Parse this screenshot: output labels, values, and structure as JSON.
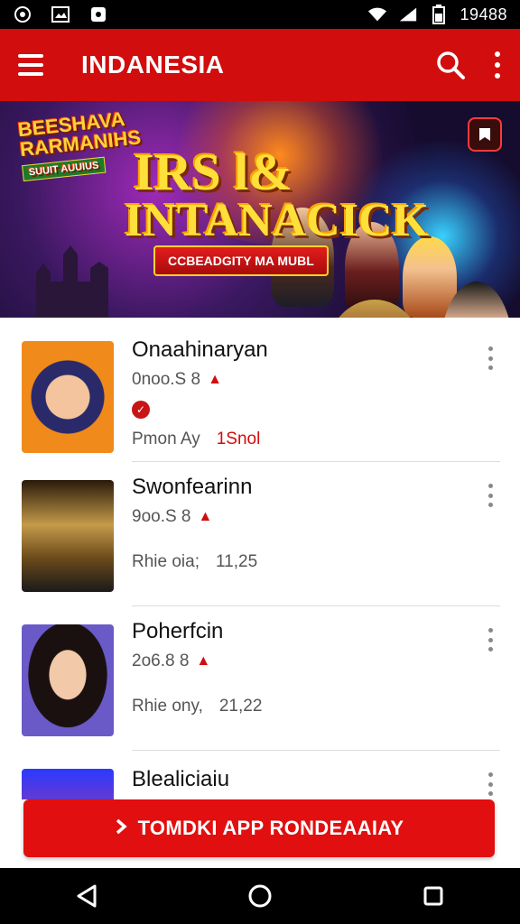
{
  "status_bar": {
    "time": "19488",
    "icons": [
      "whatsapp-icon",
      "image-icon",
      "shield-icon",
      "wifi-icon",
      "signal-icon",
      "battery-icon"
    ]
  },
  "app_bar": {
    "title": "INDANESIA",
    "color": "#d10d0d"
  },
  "banner": {
    "logo_line1": "BEESHAVA",
    "logo_line2": "RARMANIHS",
    "logo_sub": "SUUIT AUUIUS",
    "headline_l1": "IRS l&",
    "headline_l2": "INTANACICK",
    "tagline": "CCBEADGITY MA MUBL"
  },
  "list": {
    "items": [
      {
        "name": "Onaahinaryan",
        "meta1": "0noo.S 8",
        "meta2_label": "Pmon Ay",
        "meta2_value": "1Snol",
        "value_red": true,
        "badge": true
      },
      {
        "name": "Swonfearinn",
        "meta1": "9oo.S 8",
        "meta2_label": "Rhie oia;",
        "meta2_value": "11,25",
        "value_red": false,
        "badge": false
      },
      {
        "name": "Poherfcin",
        "meta1": "2o6.8 8",
        "meta2_label": "Rhie ony,",
        "meta2_value": "21,22",
        "value_red": false,
        "badge": false
      },
      {
        "name": "Blealiciaiu"
      }
    ]
  },
  "cta": {
    "label": "TOMDKI APP RONDEAAIAY",
    "color": "#e10f0f"
  },
  "nav": {
    "icons": [
      "back-icon",
      "home-icon",
      "recents-icon"
    ]
  }
}
